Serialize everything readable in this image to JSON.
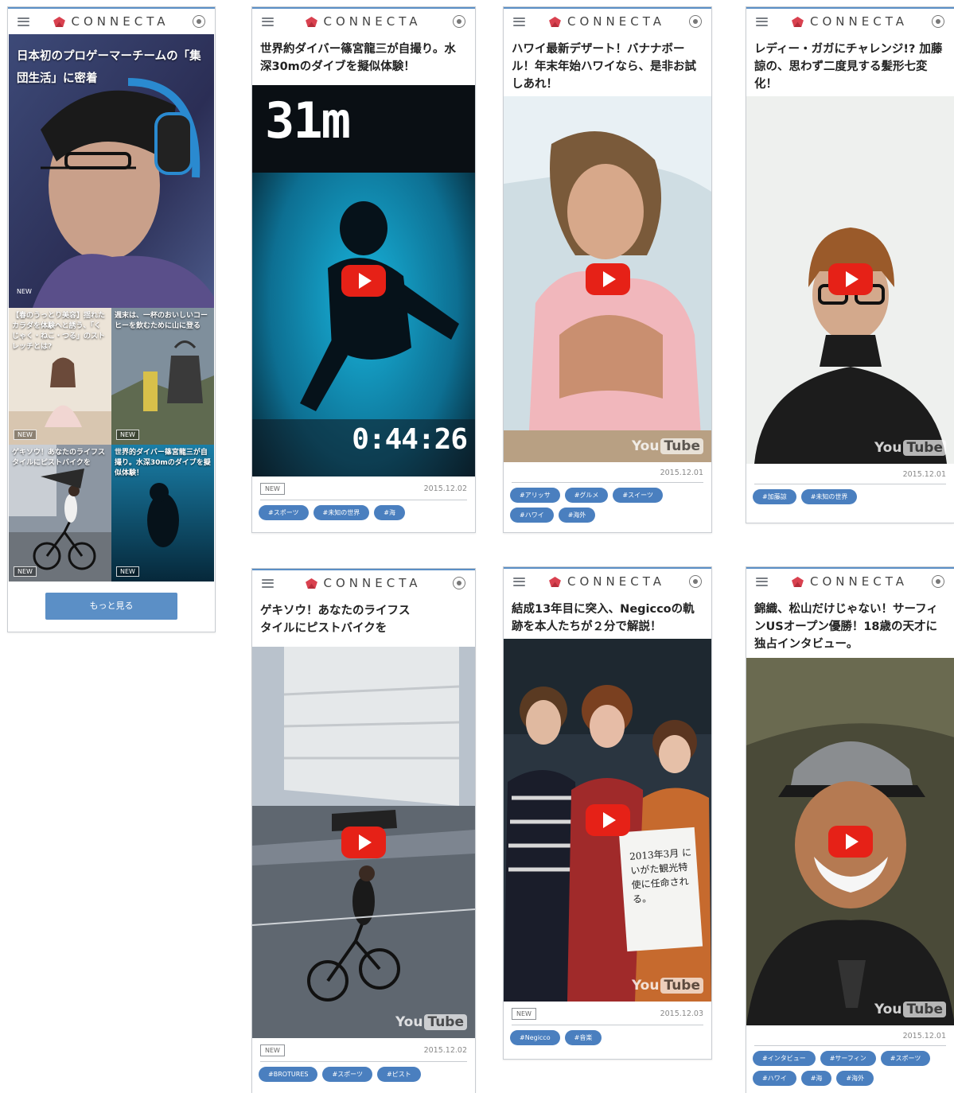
{
  "brand": {
    "name": "CONNECTA",
    "accent": "#5b8fc6",
    "tag_color": "#4a7fbf",
    "logo_color": "#d9414f"
  },
  "icons": {
    "menu": "menu-icon",
    "settings": "settings-icon",
    "play": "play-icon",
    "youtube": "youtube-logo"
  },
  "youtube": {
    "you": "You",
    "tube": "Tube"
  },
  "home": {
    "hero_title": "日本初のプロゲーマーチームの「集団生活」に密着",
    "hero_badge": "NEW",
    "grid": [
      {
        "title": "【春のうっとり美容】揺れたカラダを体験へと誘う、「くじゃく・ねこ・つる」のストレッチとは?",
        "badge": "NEW"
      },
      {
        "title": "週末は、一杯のおいしいコーヒーを飲むために山に登る",
        "badge": "NEW"
      },
      {
        "title": "ゲキソウ！あなたのライフスタイルにピストバイクを",
        "badge": "NEW"
      },
      {
        "title": "世界的ダイバー篠宮龍三が自撮り。水深30mのダイブを擬似体験！",
        "badge": "NEW"
      }
    ],
    "more_label": "もっと見る"
  },
  "cards": [
    {
      "title": "世界約ダイバー篠宮龍三が自撮り。水深30mのダイブを擬似体験！",
      "depth": "31m",
      "timer": "0:44:26",
      "badge": "NEW",
      "date": "2015.12.02",
      "tags": [
        "#スポーツ",
        "#未知の世界",
        "#海"
      ]
    },
    {
      "title": "ハワイ最新デザート！バナナボール！年末年始ハワイなら、是非お試しあれ！",
      "badge": "",
      "date": "2015.12.01",
      "tags": [
        "#アリッサ",
        "#グルメ",
        "#スイーツ",
        "#ハワイ",
        "#海外"
      ]
    },
    {
      "title": "レディー・ガガにチャレンジ!? 加藤 諒の、思わず二度見する髪形七変化！",
      "badge": "",
      "date": "2015.12.01",
      "tags": [
        "#加藤諒",
        "#未知の世界"
      ]
    },
    {
      "title": "ゲキソウ！あなたのライフスタイルにピストバイクを",
      "badge": "NEW",
      "date": "2015.12.02",
      "tags": [
        "#BROTURES",
        "#スポーツ",
        "#ピスト"
      ]
    },
    {
      "title": "結成13年目に突入、Negiccoの軌跡を本人たちが２分で解説！",
      "sign": "2013年3月 にいがた観光特使に任命される。",
      "badge": "NEW",
      "date": "2015.12.03",
      "tags": [
        "#Negicco",
        "#音楽"
      ]
    },
    {
      "title": "錦織、松山だけじゃない！サーフィンUSオープン優勝！18歳の天才に独占インタビュー。",
      "badge": "",
      "date": "2015.12.01",
      "tags": [
        "#インタビュー",
        "#サーフィン",
        "#スポーツ",
        "#ハワイ",
        "#海",
        "#海外"
      ]
    }
  ]
}
